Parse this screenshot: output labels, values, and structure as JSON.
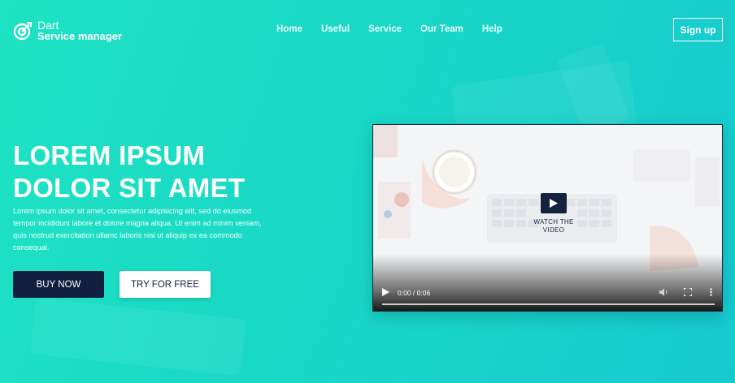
{
  "brand": {
    "line1": "Dart",
    "line2": "Service manager",
    "icon": "target-icon"
  },
  "nav": {
    "items": [
      "Home",
      "Useful",
      "Service",
      "Our Team",
      "Help"
    ]
  },
  "header": {
    "signup_label": "Sign up"
  },
  "hero": {
    "title_line1": "LOREM IPSUM",
    "title_line2": "DOLOR SIT AMET",
    "description": "Lorem ipsum dolor sit amet, consectetur adipisicing elit, sed do eiusmod tempor incididunt labore et dolore magna aliqua. Ut enim ad minim veniam, quis nostrud exercitation ullamc laboris nisi ut aliquip ex ea commodo consequal.",
    "buy_label": "BUY NOW",
    "try_label": "TRY FOR FREE"
  },
  "video": {
    "watch_line1": "WATCH THE",
    "watch_line2": "VIDEO",
    "time": "0:00 / 0:06",
    "progress": 0
  },
  "colors": {
    "accent": "#1de3c2",
    "dark": "#0f1f3d",
    "white": "#ffffff"
  }
}
